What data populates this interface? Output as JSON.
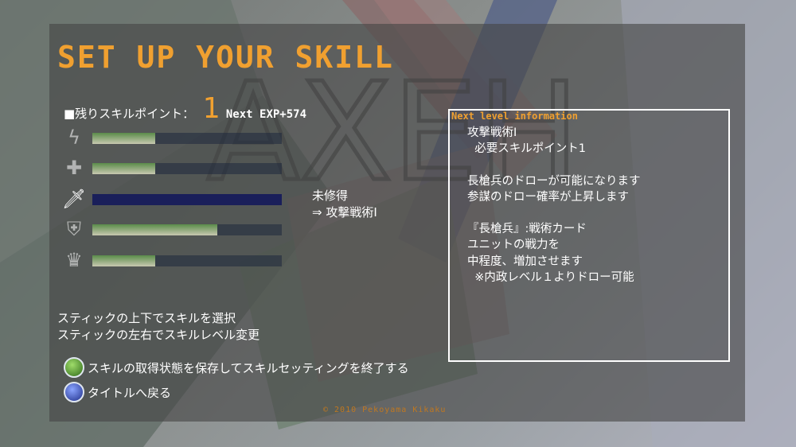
{
  "screen": {
    "title": "SET UP YOUR SKILL",
    "skill_points_label": "■残りスキルポイント：",
    "skill_points_value": "1",
    "next_exp": "Next EXP+574"
  },
  "colors": {
    "accent": "#f0a030",
    "panel": "#464646",
    "text": "#ffffff",
    "bar_selected": "#1a1f5a"
  },
  "skills": [
    {
      "icon": "lightning-icon",
      "glyph": "ϟ",
      "level": 0.33,
      "selected": false
    },
    {
      "icon": "cross-icon",
      "glyph": "✚",
      "level": 0.33,
      "selected": false
    },
    {
      "icon": "sword-icon",
      "glyph": "🗡",
      "level": 0.0,
      "selected": true
    },
    {
      "icon": "shield-icon",
      "glyph": "⛨",
      "level": 0.66,
      "selected": false
    },
    {
      "icon": "crown-icon",
      "glyph": "♛",
      "level": 0.33,
      "selected": false
    }
  ],
  "selected_skill": {
    "status": "未修得",
    "next": "⇒ 攻撃戦術Ⅰ"
  },
  "info": {
    "title": "Next level information",
    "lines": [
      "攻撃戦術Ⅰ",
      "  必要スキルポイント1",
      "",
      "長槍兵のドローが可能になります",
      "参謀のドロー確率が上昇します",
      "",
      "『長槍兵』:戦術カード",
      "ユニットの戦力を",
      "中程度、増加させます",
      "  ※内政レベル１よりドロー可能"
    ]
  },
  "help": {
    "line1": "スティックの上下でスキルを選択",
    "line2": "スティックの左右でスキルレベル変更"
  },
  "buttons": {
    "save_label": "スキルの取得状態を保存してスキルセッティングを終了する",
    "back_label": "タイトルへ戻る"
  },
  "copyright": "© 2010 Pekoyama Kikaku"
}
